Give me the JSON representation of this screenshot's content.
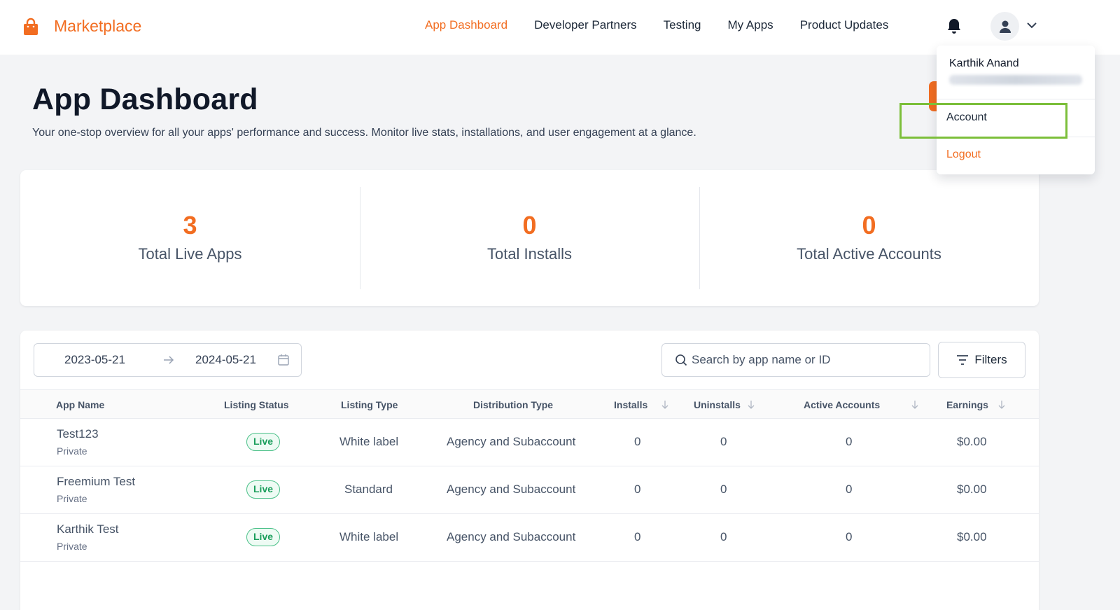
{
  "brand": {
    "name": "Marketplace",
    "color": "#f26d21"
  },
  "nav": {
    "items": [
      "App Dashboard",
      "Developer Partners",
      "Testing",
      "My Apps",
      "Product Updates"
    ],
    "active": "App Dashboard"
  },
  "header": {
    "title": "App Dashboard",
    "subtitle": "Your one-stop overview for all your apps' performance and success. Monitor live stats, installations, and user engagement at a glance."
  },
  "stats": [
    {
      "value": "3",
      "label": "Total Live Apps"
    },
    {
      "value": "0",
      "label": "Total Installs"
    },
    {
      "value": "0",
      "label": "Total Active Accounts"
    }
  ],
  "toolbar": {
    "date_start": "2023-05-21",
    "date_end": "2024-05-21",
    "search_placeholder": "Search by app name or ID",
    "filters_label": "Filters"
  },
  "table": {
    "columns": [
      "App Name",
      "Listing Status",
      "Listing Type",
      "Distribution Type",
      "Installs",
      "Uninstalls",
      "Active Accounts",
      "Earnings"
    ],
    "rows": [
      {
        "name": "Test123",
        "visibility": "Private",
        "status": "Live",
        "type": "White label",
        "distribution": "Agency and Subaccount",
        "installs": "0",
        "uninstalls": "0",
        "active_accounts": "0",
        "earnings": "$0.00"
      },
      {
        "name": "Freemium Test",
        "visibility": "Private",
        "status": "Live",
        "type": "Standard",
        "distribution": "Agency and Subaccount",
        "installs": "0",
        "uninstalls": "0",
        "active_accounts": "0",
        "earnings": "$0.00"
      },
      {
        "name": "Karthik Test",
        "visibility": "Private",
        "status": "Live",
        "type": "White label",
        "distribution": "Agency and Subaccount",
        "installs": "0",
        "uninstalls": "0",
        "active_accounts": "0",
        "earnings": "$0.00"
      }
    ]
  },
  "user_menu": {
    "name": "Karthik Anand",
    "account_label": "Account",
    "logout_label": "Logout"
  },
  "icons": {
    "brand": "shopping-bag-icon",
    "notifications": "bell-icon",
    "avatar": "user-icon",
    "menu_toggle": "chevron-down-icon",
    "date_separator": "arrow-right-icon",
    "calendar": "calendar-icon",
    "search": "search-icon",
    "filters": "filter-icon",
    "sort": "arrow-down-icon"
  },
  "colors": {
    "accent": "#f26d21",
    "live_badge": "#1a9e5b",
    "highlight": "#7cbf3a"
  }
}
